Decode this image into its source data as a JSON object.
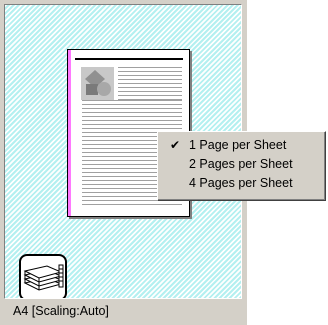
{
  "preview": {
    "pages_icon": "stacked-pages-icon",
    "page_image_icon": "shapes-image-icon",
    "check_icon": "checkmark-icon"
  },
  "context_menu": {
    "items": [
      {
        "label": "1 Page per Sheet",
        "checked": true
      },
      {
        "label": "2 Pages per Sheet",
        "checked": false
      },
      {
        "label": "4 Pages per Sheet",
        "checked": false
      }
    ]
  },
  "status": {
    "paper_label": "A4 [Scaling:Auto]"
  },
  "colors": {
    "panel_bg": "#d4d0c8",
    "preview_bg": "#b4f0f0",
    "margin_marker": "#ff78ff"
  }
}
